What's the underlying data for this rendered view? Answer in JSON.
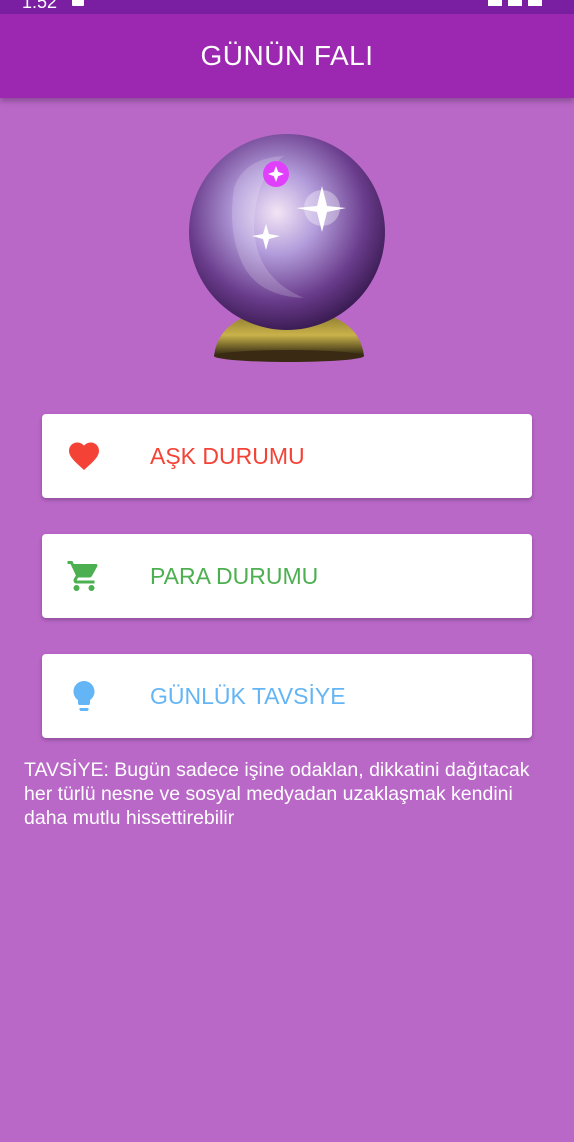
{
  "status_bar": {
    "time": "1:52"
  },
  "app_bar": {
    "title": "GÜNÜN FALI"
  },
  "buttons": {
    "love": {
      "label": "AŞK DURUMU",
      "icon": "heart-icon",
      "color": "#f44336"
    },
    "money": {
      "label": "PARA DURUMU",
      "icon": "cart-icon",
      "color": "#4caf50"
    },
    "advice": {
      "label": "GÜNLÜK TAVSİYE",
      "icon": "lightbulb-icon",
      "color": "#64b5f6"
    }
  },
  "result": {
    "text": "TAVSİYE: Bugün sadece işine odaklan, dikkatini dağıtacak her türlü nesne ve sosyal medyadan uzaklaşmak kendini daha mutlu hissettirebilir"
  },
  "colors": {
    "background": "#ba68c8",
    "app_bar": "#9c27b0",
    "status_bar": "#7b1fa2"
  }
}
